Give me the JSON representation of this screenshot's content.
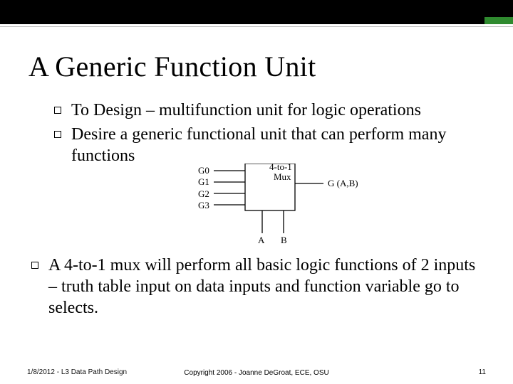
{
  "header": {
    "title": "A Generic Function Unit"
  },
  "bullets": {
    "b1": "To Design – multifunction unit for logic operations",
    "b2": "Desire a generic functional unit that can perform many functions",
    "b3": "A 4-to-1 mux will perform all basic logic functions of 2 inputs – truth table input on data inputs and function variable go to selects."
  },
  "diagram": {
    "inputs": {
      "g0": "G0",
      "g1": "G1",
      "g2": "G2",
      "g3": "G3"
    },
    "box_top": "4-to-1",
    "box_sub": "Mux",
    "output": "G (A,B)",
    "selects": {
      "a": "A",
      "b": "B"
    }
  },
  "footer": {
    "left": "1/8/2012 - L3 Data Path Design",
    "center": "Copyright 2006 - Joanne DeGroat, ECE, OSU",
    "right": "11"
  }
}
